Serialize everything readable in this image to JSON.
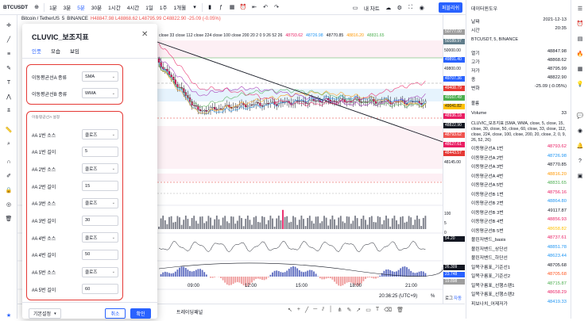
{
  "topbar": {
    "symbol": "BTCUSDT",
    "intervals": [
      "1분",
      "3분",
      "5분",
      "30분",
      "1시간",
      "4시간",
      "1일",
      "1주",
      "1개월"
    ],
    "active_interval": "5분",
    "template": "내 차트",
    "save": "저장",
    "publish": "퍼블리쉬"
  },
  "legend": {
    "title": "Bitcoin / TetherUS",
    "interval": "5",
    "exchange": "BINANCE",
    "ohlc": "H48847.98  L48868.62  L48795.99  C48822.90  -25.09 (-0.05%)",
    "indicator": "close 33 close 112 close 224 close 100 close 200  20  2  0  9 26 52 26",
    "values": [
      "48793.62",
      "48726.98",
      "48770.85",
      "48816.20",
      "48831.65"
    ]
  },
  "dialog": {
    "title": "CLUVIC_보조지표",
    "tabs": [
      "인풋",
      "모습",
      "보임"
    ],
    "active_tab": "인풋",
    "ma_rows": [
      {
        "label": "이동평균선A 종류",
        "value": "SMA"
      },
      {
        "label": "이동평균선B 종류",
        "value": "WMA"
      }
    ],
    "section_label": "이동평균선A 설정",
    "ma_settings": [
      {
        "label": "#A 1번 소스",
        "value": "클로즈",
        "dropdown": true
      },
      {
        "label": "#A 1번 길이",
        "value": "5",
        "dropdown": false
      },
      {
        "label": "#A 2번 소스",
        "value": "클로즈",
        "dropdown": true
      },
      {
        "label": "#A 2번 길이",
        "value": "15",
        "dropdown": false
      },
      {
        "label": "#A 3번 소스",
        "value": "클로즈",
        "dropdown": true
      },
      {
        "label": "#A 3번 길이",
        "value": "30",
        "dropdown": false
      },
      {
        "label": "#A 4번 소스",
        "value": "클로즈",
        "dropdown": true
      },
      {
        "label": "#A 4번 길이",
        "value": "50",
        "dropdown": false
      },
      {
        "label": "#A 5번 소스",
        "value": "클로즈",
        "dropdown": true
      },
      {
        "label": "#A 5번 길이",
        "value": "60",
        "dropdown": false
      }
    ],
    "defaults_btn": "기본설정",
    "cancel_btn": "취소",
    "ok_btn": "확인"
  },
  "price_axis": {
    "labels": [
      "50777.00",
      "50189.97",
      "50000.00",
      "49891.40",
      "49800.00",
      "49707.36",
      "49408.79",
      "49167.49",
      "49041.82",
      "48936.18",
      "48822.90",
      "48793.62",
      "48627.61",
      "48443.57",
      "48145.00"
    ],
    "vol_labels": [
      "100",
      "5",
      "0"
    ],
    "osc_labels": [
      "54.20",
      "26.309",
      "23.748",
      "19.898"
    ]
  },
  "time_axis": {
    "labels": [
      "09:00",
      "12:00",
      "15:00",
      "18:00",
      "21:00"
    ],
    "clock": "20:36:25 (UTC+9)",
    "percent": "%",
    "log": "로그",
    "auto": "자동"
  },
  "bottombar": {
    "label": "트레이딩패널"
  },
  "data_window": {
    "title": "데이터윈도우",
    "date_label": "날짜",
    "date": "2021-12-13",
    "time_label": "시간",
    "time": "20:35",
    "symbol": "BTCUSDT, 5, BINANCE",
    "ohlc": [
      {
        "label": "열기",
        "value": "48847.98"
      },
      {
        "label": "고가",
        "value": "48868.62"
      },
      {
        "label": "저가",
        "value": "48795.99"
      },
      {
        "label": "종",
        "value": "48822.90"
      },
      {
        "label": "변화",
        "value": "-25.09 (-0.05%)"
      }
    ],
    "volume_title": "볼륨",
    "volume_label": "Volume",
    "volume": "33",
    "indicator_desc": "CLUVIC_보조지표 (SMA, WMA, close, 5, close, 15, close, 30, close, 50, close, 60, close, 33, close, 112, close, 224, close, 100, close, 200, 20, close, 2, 0, 9, 26, 52, 26)",
    "indicator_rows": [
      {
        "label": "이동평균선A 1번",
        "value": "48793.62",
        "color": "#e91e63"
      },
      {
        "label": "이동평균선A 2번",
        "value": "48726.98",
        "color": "#2196f3"
      },
      {
        "label": "이동평균선A 3번",
        "value": "48770.85",
        "color": "#131722"
      },
      {
        "label": "이동평균선A 4번",
        "value": "48816.20",
        "color": "#ff9800"
      },
      {
        "label": "이동평균선A 5번",
        "value": "48831.65",
        "color": "#4caf50"
      },
      {
        "label": "이동평균선B 1번",
        "value": "48756.16",
        "color": "#e91e63"
      },
      {
        "label": "이동평균선B 2번",
        "value": "48864.80",
        "color": "#2196f3"
      },
      {
        "label": "이동평균선B 3번",
        "value": "49117.87",
        "color": "#131722"
      },
      {
        "label": "이동평균선B 4번",
        "value": "48856.93",
        "color": "#e91e63"
      },
      {
        "label": "이동평균선B 5번",
        "value": "48658.82",
        "color": "#ffc107"
      },
      {
        "label": "볼린저밴드_basis",
        "value": "48737.61",
        "color": "#e91e63"
      },
      {
        "label": "볼린저밴드_상단선",
        "value": "48851.78",
        "color": "#2196f3"
      },
      {
        "label": "볼린저밴드_하단선",
        "value": "48623.44",
        "color": "#2196f3"
      },
      {
        "label": "일목구름표_기준선1",
        "value": "48705.68",
        "color": "#131722"
      },
      {
        "label": "일목구름표_기준선2",
        "value": "48705.68",
        "color": "#ff5722"
      },
      {
        "label": "일목구름표_선행스팬1",
        "value": "48715.87",
        "color": "#4caf50"
      },
      {
        "label": "일목구름표_선행스팬2",
        "value": "48658.29",
        "color": "#e91e63"
      },
      {
        "label": "피보나치_어제저가",
        "value": "48419.33",
        "color": "#2196f3"
      }
    ]
  },
  "colors": {
    "accent": "#2962ff",
    "up": "#26a69a",
    "down": "#ef5350",
    "candle_up": "#ffffff",
    "candle_down": "#131722",
    "highlight_red": "#e53935"
  }
}
